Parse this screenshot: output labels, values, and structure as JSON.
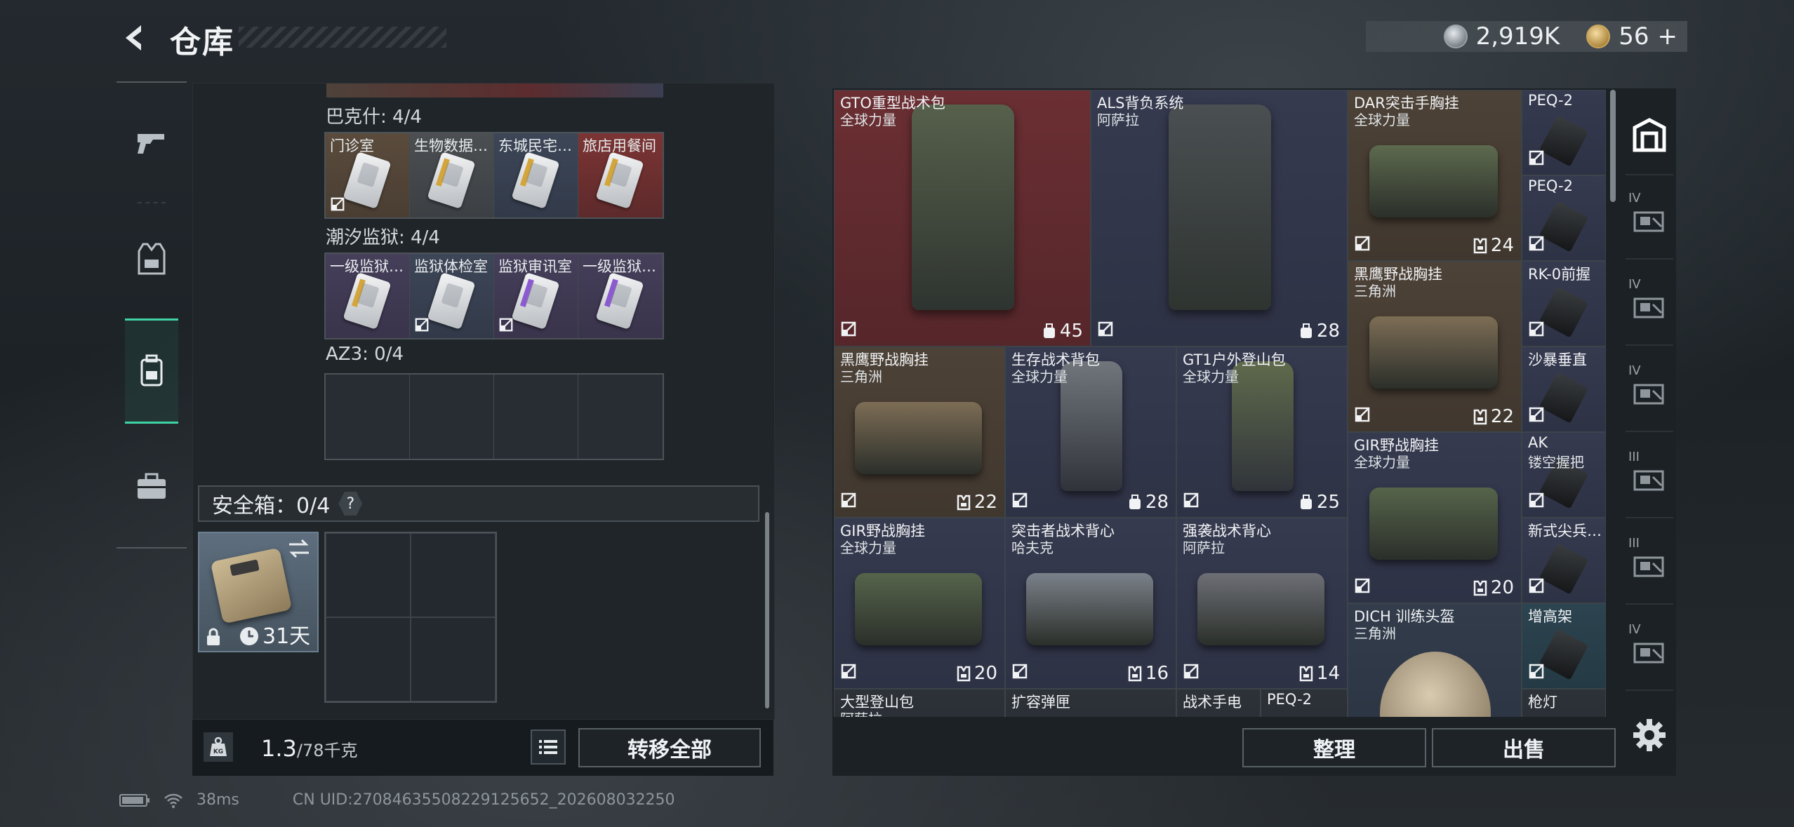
{
  "header": {
    "title": "仓库",
    "currency": {
      "silver_value": "2,919K",
      "gold_value": "56",
      "gold_add": "+"
    }
  },
  "left_nav": {
    "items": [
      {
        "icon": "pistol-icon",
        "active": false
      },
      {
        "icon": "armor-vest-icon",
        "active": false
      },
      {
        "icon": "backpack-icon",
        "active": true
      },
      {
        "icon": "briefcase-icon",
        "active": false
      }
    ]
  },
  "containers": [
    {
      "label": "巴克什: 4/4",
      "cells": [
        {
          "name": "门诊室",
          "bg": "tan",
          "card": "plain",
          "nostack": true
        },
        {
          "name": "生物数据…",
          "bg": "gray",
          "card": "gold",
          "nostack": false
        },
        {
          "name": "东城民宅…",
          "bg": "blue",
          "card": "gold",
          "nostack": false
        },
        {
          "name": "旅店用餐间",
          "bg": "red",
          "card": "gold",
          "nostack": false
        }
      ]
    },
    {
      "label": "潮汐监狱: 4/4",
      "cells": [
        {
          "name": "一级监狱…",
          "bg": "purple",
          "card": "gold",
          "nostack": false
        },
        {
          "name": "监狱体检室",
          "bg": "blue",
          "card": "plain",
          "nostack": true
        },
        {
          "name": "监狱审讯室",
          "bg": "purple",
          "card": "purple",
          "nostack": true
        },
        {
          "name": "一级监狱…",
          "bg": "purple",
          "card": "purple",
          "nostack": false
        }
      ]
    },
    {
      "label": "AZ3: 0/4",
      "cells": [
        {
          "name": "",
          "bg": "empty"
        },
        {
          "name": "",
          "bg": "empty"
        },
        {
          "name": "",
          "bg": "empty"
        },
        {
          "name": "",
          "bg": "empty"
        }
      ]
    }
  ],
  "safebox": {
    "label": "安全箱：0/4",
    "help": "?",
    "duration": "31天"
  },
  "weight": {
    "current": "1.3",
    "max": "/78千克"
  },
  "buttons": {
    "transfer_all": "转移全部",
    "organize": "整理",
    "sell": "出售"
  },
  "stash_items": [
    {
      "name": "GTO重型战术包",
      "sub": "全球力量",
      "cap": "45",
      "cap_icon": "backpack-capacity-icon",
      "type": "backpack",
      "color": "#56604b",
      "bg": "maroon"
    },
    {
      "name": "ALS背负系统",
      "sub": "阿萨拉",
      "cap": "28",
      "cap_icon": "backpack-capacity-icon",
      "type": "backpack",
      "color": "#4a4f52",
      "bg": "navy"
    },
    {
      "name": "DAR突击手胸挂",
      "sub": "全球力量",
      "cap": "24",
      "cap_icon": "vest-capacity-icon",
      "type": "rig",
      "color": "#5d6a4e",
      "bg": "brown"
    },
    {
      "name": "PEQ-2",
      "sub": "",
      "type": "attachment",
      "bg": "navy"
    },
    {
      "name": "PEQ-2",
      "sub": "",
      "type": "attachment",
      "bg": "navy"
    },
    {
      "name": "黑鹰野战胸挂",
      "sub": "三角洲",
      "cap": "22",
      "cap_icon": "vest-capacity-icon",
      "type": "rig",
      "color": "#7d6d55",
      "bg": "brown"
    },
    {
      "name": "RK-0前握",
      "sub": "",
      "type": "attachment",
      "bg": "navy"
    },
    {
      "name": "沙暴垂直",
      "sub": "",
      "type": "attachment",
      "bg": "navy"
    },
    {
      "name": "黑鹰野战胸挂",
      "sub": "三角洲",
      "cap": "22",
      "cap_icon": "vest-capacity-icon",
      "type": "rig",
      "color": "#7d6d55",
      "bg": "brown"
    },
    {
      "name": "生存战术背包",
      "sub": "全球力量",
      "cap": "28",
      "cap_icon": "backpack-capacity-icon",
      "type": "pack",
      "color": "#70767c",
      "bg": "navy"
    },
    {
      "name": "GT1户外登山包",
      "sub": "全球力量",
      "cap": "25",
      "cap_icon": "backpack-capacity-icon",
      "type": "pack",
      "color": "#5f6a4c",
      "bg": "navy"
    },
    {
      "name": "GIR野战胸挂",
      "sub": "全球力量",
      "cap": "20",
      "cap_icon": "vest-capacity-icon",
      "type": "rig",
      "color": "#56644b",
      "bg": "navy"
    },
    {
      "name": "AK",
      "sub": "镂空握把",
      "type": "attachment",
      "bg": "navy"
    },
    {
      "name": "新式尖兵…",
      "sub": "",
      "type": "attachment",
      "bg": "navy"
    },
    {
      "name": "GIR野战胸挂",
      "sub": "全球力量",
      "cap": "20",
      "cap_icon": "vest-capacity-icon",
      "type": "rig",
      "color": "#56644b",
      "bg": "navy"
    },
    {
      "name": "突击者战术背心",
      "sub": "哈夫克",
      "cap": "16",
      "cap_icon": "vest-capacity-icon",
      "type": "rig",
      "color": "#7b818a",
      "bg": "navy"
    },
    {
      "name": "强袭战术背心",
      "sub": "阿萨拉",
      "cap": "14",
      "cap_icon": "vest-capacity-icon",
      "type": "rig",
      "color": "#6d6f76",
      "bg": "navy"
    },
    {
      "name": "DICH 训练头盔",
      "sub": "三角洲",
      "type": "helmet",
      "bg": "steel"
    },
    {
      "name": "增高架",
      "sub": "",
      "type": "attachment",
      "bg": "teal"
    },
    {
      "name": "大型登山包",
      "sub": "阿萨拉",
      "type": "partial",
      "bg": "dark"
    },
    {
      "name": "扩容弹匣",
      "sub": "",
      "type": "partial",
      "bg": "dark"
    },
    {
      "name": "战术手电",
      "sub": "",
      "type": "partial",
      "bg": "dark"
    },
    {
      "name": "PEQ-2",
      "sub": "",
      "type": "partial",
      "bg": "dark"
    },
    {
      "name": "枪灯",
      "sub": "",
      "type": "partial",
      "bg": "dark"
    }
  ],
  "right_nav": {
    "items": [
      {
        "tier": "",
        "icon": "stash-icon"
      },
      {
        "tier": "IV",
        "icon": "weapon-case-icon"
      },
      {
        "tier": "IV",
        "icon": "ammo-box-icon"
      },
      {
        "tier": "IV",
        "icon": "tool-case-icon"
      },
      {
        "tier": "III",
        "icon": "hazard-box-icon"
      },
      {
        "tier": "III",
        "icon": "gun-rack-icon"
      },
      {
        "tier": "IV",
        "icon": "crate-icon"
      }
    ]
  },
  "status_bar": {
    "ping": "38ms",
    "uid": "CN UID:27084635508229125652_202608032250"
  },
  "colors": {
    "accent": "#3fd3a3",
    "panel": "#1f2529"
  }
}
